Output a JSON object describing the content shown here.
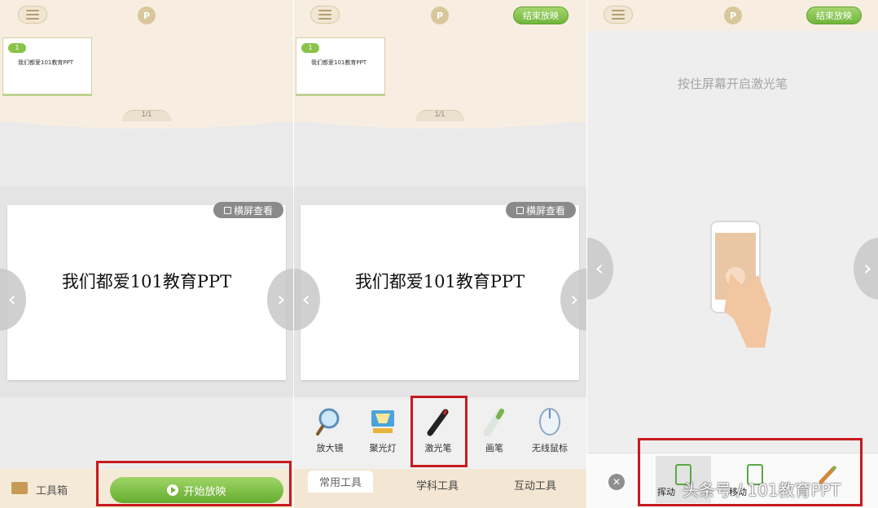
{
  "panel1": {
    "thumb_badge": "1",
    "thumb_text": "我们都爱101教育PPT",
    "pager": "1/1",
    "landscape": "横屏查看",
    "slide_text": "我们都爱101教育PPT",
    "toolbox": "工具箱",
    "start": "开始放映"
  },
  "panel2": {
    "end": "结束放映",
    "thumb_badge": "1",
    "thumb_text": "我们都爱101教育PPT",
    "pager": "1/1",
    "landscape": "横屏查看",
    "slide_text": "我们都爱101教育PPT",
    "tools": [
      {
        "label": "放大镜",
        "icon": "magnifier-icon"
      },
      {
        "label": "聚光灯",
        "icon": "spotlight-icon"
      },
      {
        "label": "激光笔",
        "icon": "laser-pointer-icon"
      },
      {
        "label": "画笔",
        "icon": "brush-icon"
      },
      {
        "label": "无线鼠标",
        "icon": "mouse-icon"
      }
    ],
    "tabs": [
      "常用工具",
      "学科工具",
      "互动工具"
    ]
  },
  "panel3": {
    "end": "结束放映",
    "hint": "按住屏幕开启激光笔",
    "modes": [
      {
        "label": "挥动"
      },
      {
        "label": "移动"
      },
      {
        "label": ""
      }
    ]
  },
  "watermark": "头条号 / 101教育PPT",
  "colors": {
    "accent": "#6fb53a",
    "highlight": "#c8191e",
    "bg_top": "#f7eee1"
  }
}
